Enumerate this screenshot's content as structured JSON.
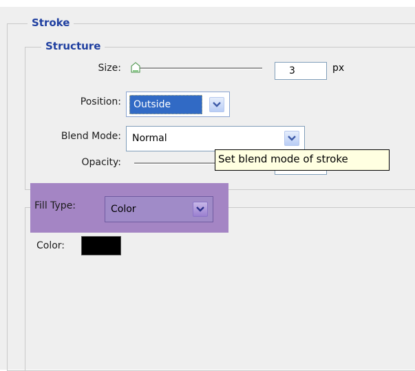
{
  "stroke": {
    "title": "Stroke",
    "structure": {
      "title": "Structure",
      "size": {
        "label": "Size:",
        "value": "3",
        "unit": "px"
      },
      "position": {
        "label": "Position:",
        "selected": "Outside"
      },
      "blend_mode": {
        "label": "Blend Mode:",
        "selected": "Normal"
      },
      "opacity": {
        "label": "Opacity:"
      }
    },
    "tooltip": "Set blend mode of stroke",
    "fill": {
      "type_label": "Fill Type:",
      "type_selected": "Color",
      "color_label": "Color:",
      "color_value": "#000000"
    }
  },
  "colors": {
    "highlight": "#a485c4",
    "legend_text": "#1f3fa0",
    "selection_bg": "#316ac5"
  }
}
